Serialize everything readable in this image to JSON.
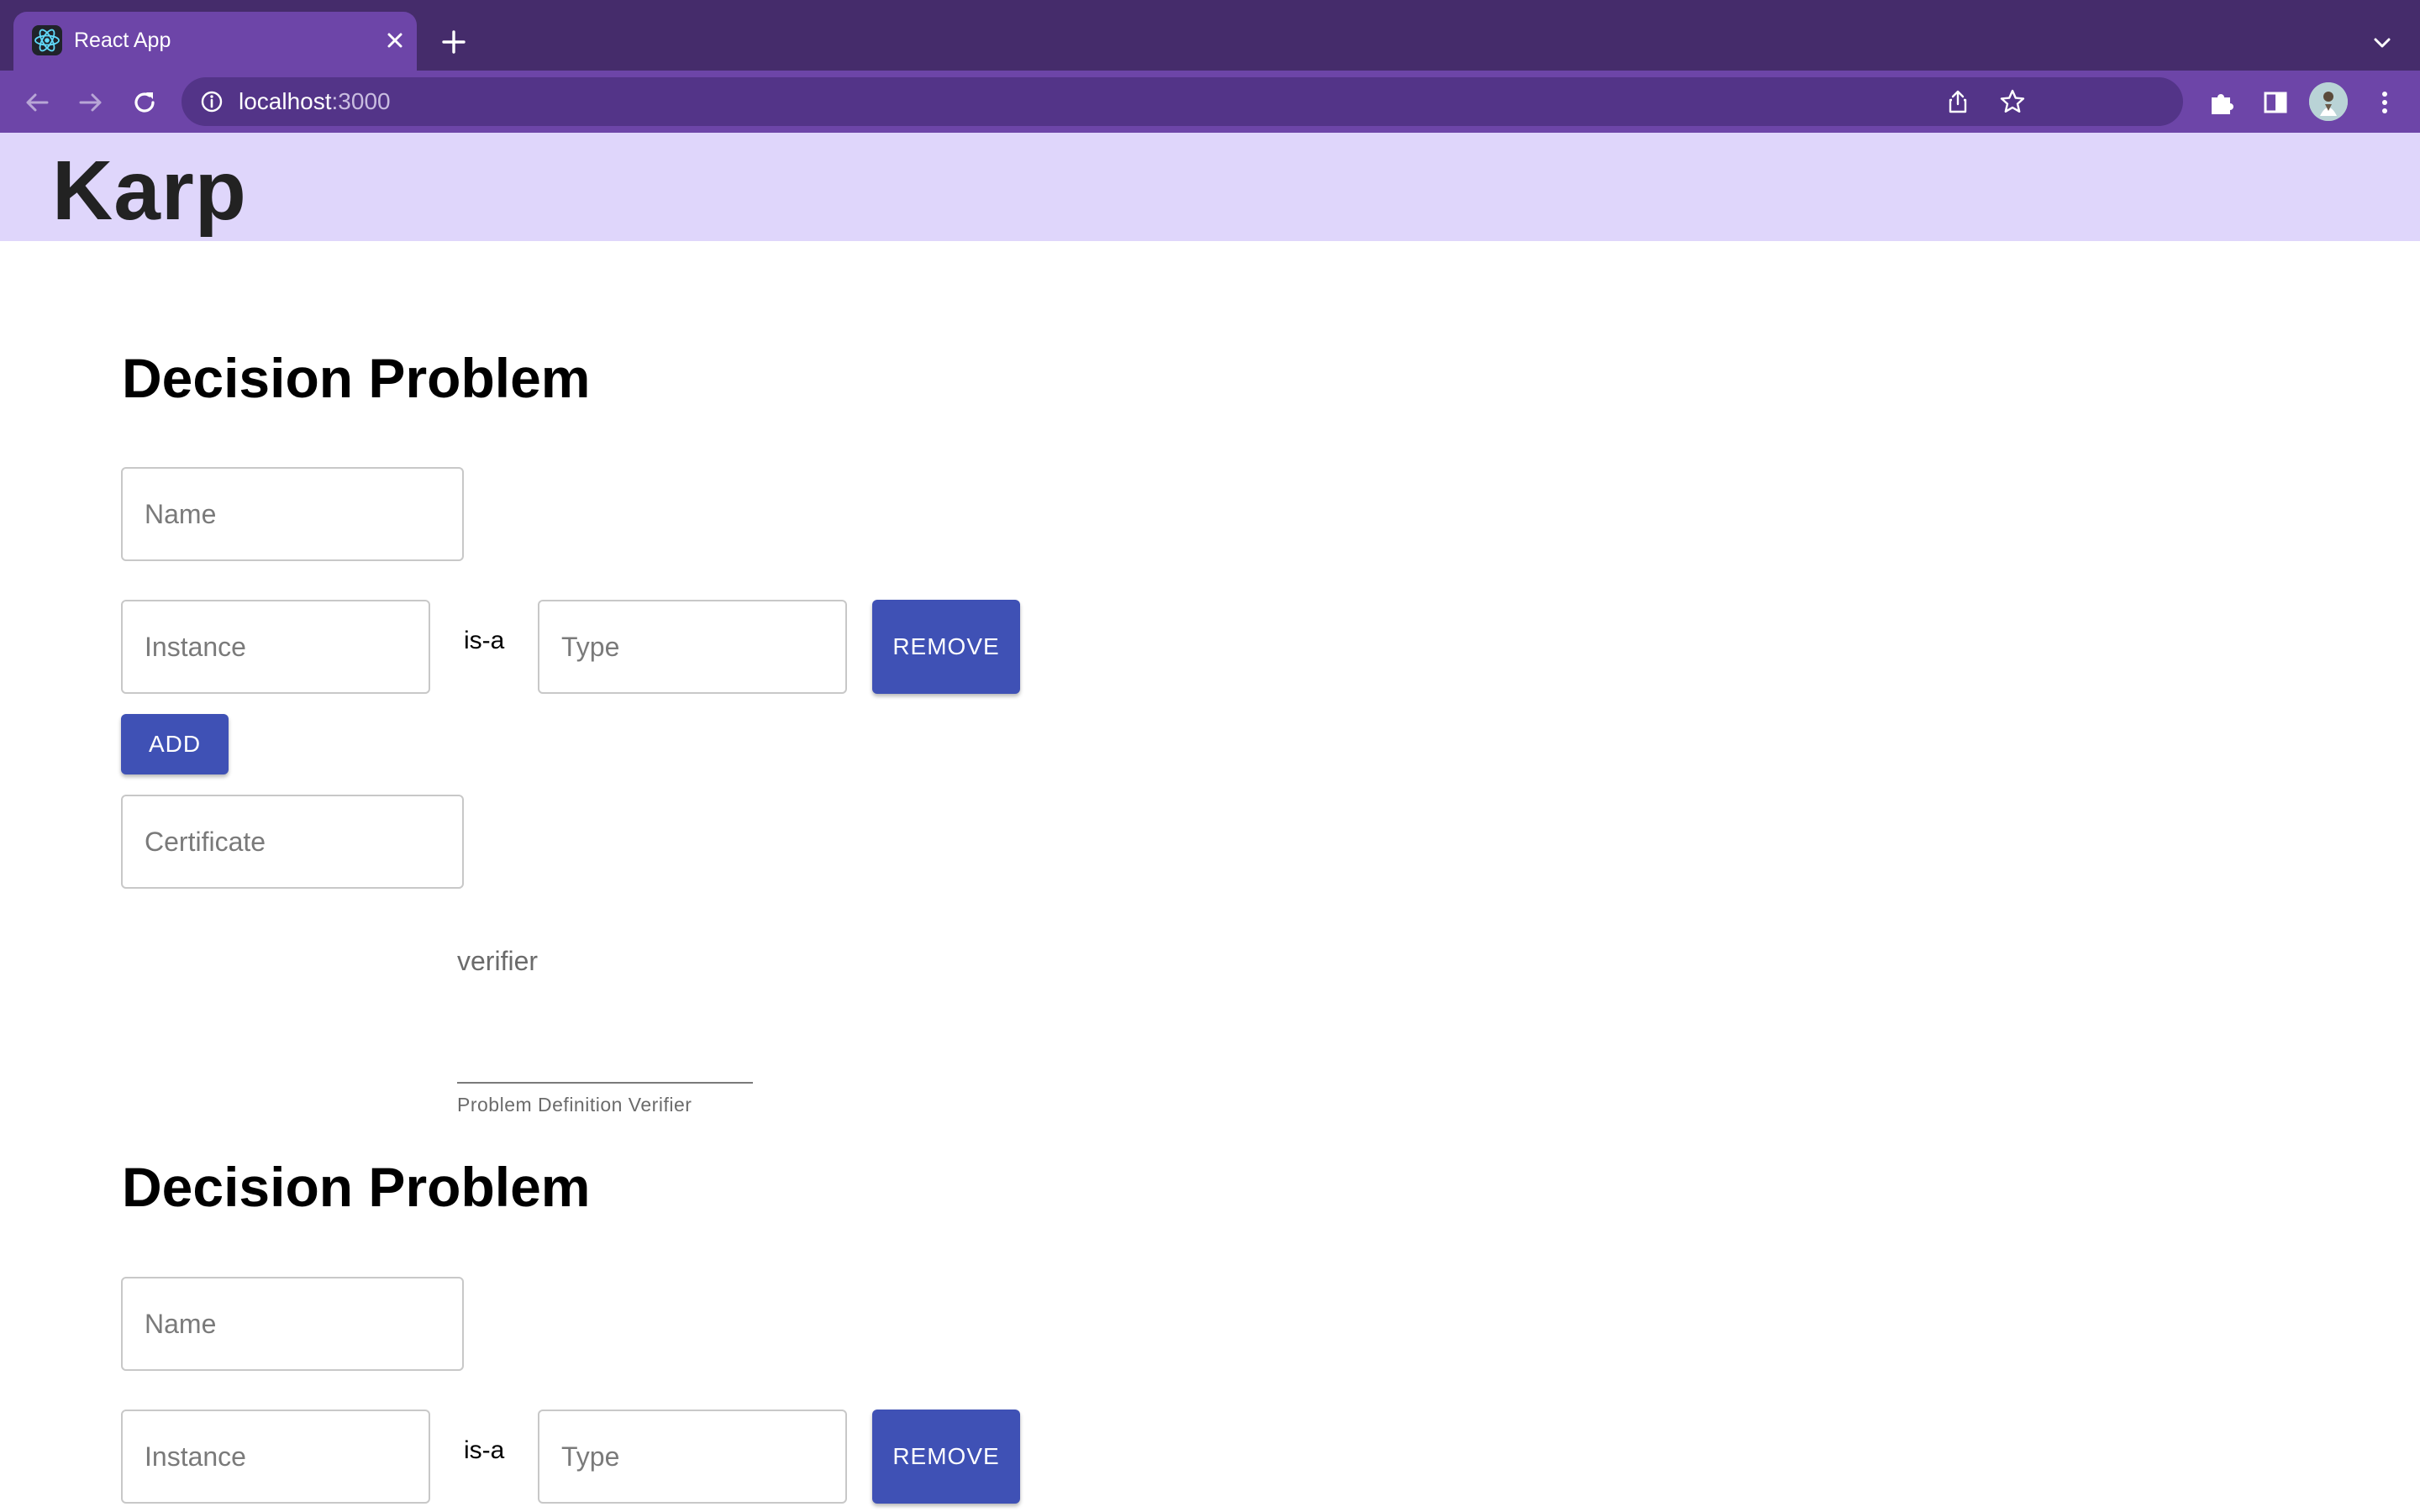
{
  "browser": {
    "tab_title": "React App",
    "url_host": "localhost",
    "url_port": ":3000",
    "theme_color": "#6d45a8"
  },
  "app": {
    "title": "Karp",
    "header_color": "#dfd6fb"
  },
  "sections": [
    {
      "heading": "Decision Problem",
      "name_placeholder": "Name",
      "instance_placeholder": "Instance",
      "is_a_label": "is-a",
      "type_placeholder": "Type",
      "remove_label": "REMOVE",
      "add_label": "ADD",
      "certificate_placeholder": "Certificate",
      "verifier_label": "verifier",
      "verifier_helper": "Problem Definition Verifier"
    },
    {
      "heading": "Decision Problem",
      "name_placeholder": "Name",
      "instance_placeholder": "Instance",
      "is_a_label": "is-a",
      "type_placeholder": "Type",
      "remove_label": "REMOVE"
    }
  ],
  "colors": {
    "button": "#3f51b5"
  }
}
